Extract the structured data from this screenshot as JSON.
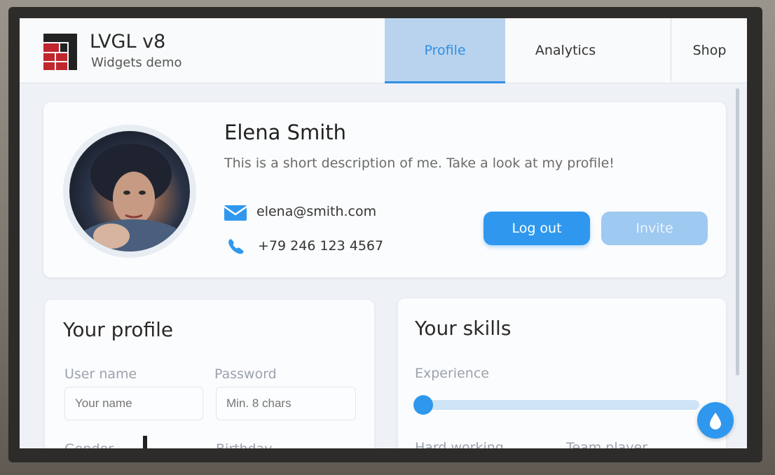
{
  "app": {
    "title": "LVGL v8",
    "subtitle": "Widgets demo"
  },
  "tabs": [
    {
      "label": "Profile",
      "active": true
    },
    {
      "label": "Analytics",
      "active": false
    },
    {
      "label": "Shop",
      "active": false
    }
  ],
  "profile": {
    "name": "Elena Smith",
    "description": "This is a short description of me. Take a look at my profile!",
    "email": "elena@smith.com",
    "phone": "+79 246 123 4567",
    "logout_label": "Log out",
    "invite_label": "Invite"
  },
  "your_profile": {
    "title": "Your profile",
    "username_label": "User name",
    "username_placeholder": "Your name",
    "password_label": "Password",
    "password_placeholder": "Min. 8 chars",
    "gender_label": "Gender",
    "birthday_label": "Birthday"
  },
  "your_skills": {
    "title": "Your skills",
    "experience_label": "Experience",
    "experience_value": 0,
    "hard_working_label": "Hard working",
    "team_player_label": "Team player"
  },
  "colors": {
    "accent": "#2f98ee",
    "accent_disabled": "#9ec9f0",
    "tab_active_bg": "#b9d3ee",
    "logo_red": "#c0262d"
  },
  "icons": {
    "email": "envelope-icon",
    "phone": "phone-icon",
    "fab": "drop-icon"
  }
}
